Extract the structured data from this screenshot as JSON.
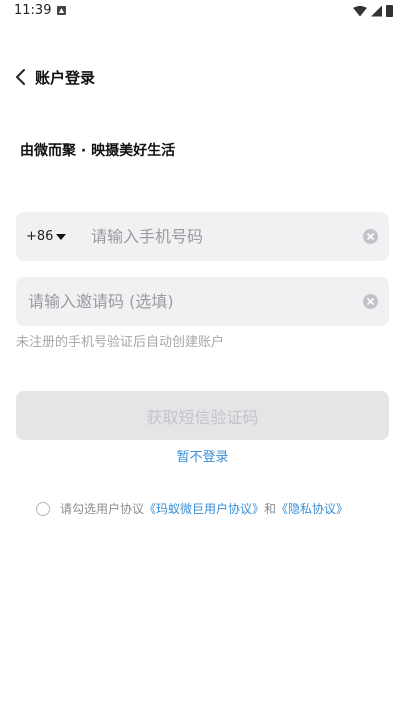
{
  "status_bar": {
    "time": "11:39",
    "notification_icon": "a-notification-icon",
    "icons": [
      "wifi-icon",
      "signal-icon",
      "battery-icon"
    ]
  },
  "header": {
    "title": "账户登录",
    "back_icon": "chevron-left-icon"
  },
  "slogan": "由微而聚 · 映摄美好生活",
  "phone_field": {
    "country_code": "+86",
    "placeholder": "请输入手机号码",
    "value": ""
  },
  "invite_field": {
    "placeholder": "请输入邀请码 (选填)",
    "value": ""
  },
  "hint": "未注册的手机号验证后自动创建账户",
  "get_code_button": "获取短信验证码",
  "skip_link": "暂不登录",
  "agreement": {
    "prefix": "请勾选用户协议",
    "user_agreement": "《玛蚁微巨用户协议》",
    "conjunction": "和",
    "privacy_policy": "《隐私协议》"
  },
  "colors": {
    "accent_link": "#3a8ed4",
    "field_background": "#f1f1f3",
    "button_disabled_background": "#e5e5e7",
    "button_disabled_text": "#c4c4c8",
    "hint_text": "#a7a7ab"
  }
}
